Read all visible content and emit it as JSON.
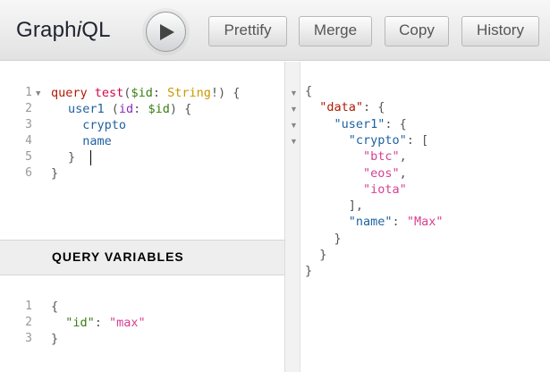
{
  "app": {
    "logo_prefix": "Graph",
    "logo_italic": "i",
    "logo_suffix": "QL"
  },
  "toolbar": {
    "execute_icon": "play-icon",
    "prettify_label": "Prettify",
    "merge_label": "Merge",
    "copy_label": "Copy",
    "history_label": "History"
  },
  "query_editor": {
    "line_numbers": [
      "1",
      "2",
      "3",
      "4",
      "5",
      "6"
    ],
    "lines": [
      [
        {
          "t": "query",
          "c": "kw"
        },
        {
          "t": " ",
          "c": "punc"
        },
        {
          "t": "test",
          "c": "def"
        },
        {
          "t": "(",
          "c": "punc"
        },
        {
          "t": "$id",
          "c": "var"
        },
        {
          "t": ": ",
          "c": "punc"
        },
        {
          "t": "String",
          "c": "type"
        },
        {
          "t": "!) {",
          "c": "punc"
        }
      ],
      [
        {
          "t": "  user1",
          "c": "prop"
        },
        {
          "t": " (",
          "c": "punc"
        },
        {
          "t": "id",
          "c": "attr"
        },
        {
          "t": ": ",
          "c": "punc"
        },
        {
          "t": "$id",
          "c": "var"
        },
        {
          "t": ") {",
          "c": "punc"
        }
      ],
      [
        {
          "t": "    crypto",
          "c": "prop"
        }
      ],
      [
        {
          "t": "    name",
          "c": "prop"
        }
      ],
      [
        {
          "t": "  }",
          "c": "punc"
        }
      ],
      [
        {
          "t": "}",
          "c": "punc"
        }
      ]
    ]
  },
  "variables": {
    "title": "QUERY VARIABLES",
    "line_numbers": [
      "1",
      "2",
      "3"
    ],
    "lines": [
      [
        {
          "t": "{",
          "c": "punc"
        }
      ],
      [
        {
          "t": "  \"id\"",
          "c": "var"
        },
        {
          "t": ": ",
          "c": "punc"
        },
        {
          "t": "\"max\"",
          "c": "str"
        }
      ],
      [
        {
          "t": "}",
          "c": "punc"
        }
      ]
    ]
  },
  "result": {
    "lines": [
      [
        {
          "t": "{",
          "c": "punc"
        }
      ],
      [
        {
          "t": "  \"data\"",
          "c": "jkey-data"
        },
        {
          "t": ": {",
          "c": "punc"
        }
      ],
      [
        {
          "t": "    \"user1\"",
          "c": "jkey"
        },
        {
          "t": ": {",
          "c": "punc"
        }
      ],
      [
        {
          "t": "      \"crypto\"",
          "c": "jkey"
        },
        {
          "t": ": [",
          "c": "punc"
        }
      ],
      [
        {
          "t": "        \"btc\"",
          "c": "str"
        },
        {
          "t": ",",
          "c": "punc"
        }
      ],
      [
        {
          "t": "        \"eos\"",
          "c": "str"
        },
        {
          "t": ",",
          "c": "punc"
        }
      ],
      [
        {
          "t": "        \"iota\"",
          "c": "str"
        }
      ],
      [
        {
          "t": "      ],",
          "c": "punc"
        }
      ],
      [
        {
          "t": "      \"name\"",
          "c": "jkey"
        },
        {
          "t": ": ",
          "c": "punc"
        },
        {
          "t": "\"Max\"",
          "c": "str"
        }
      ],
      [
        {
          "t": "    }",
          "c": "punc"
        }
      ],
      [
        {
          "t": "  }",
          "c": "punc"
        }
      ],
      [
        {
          "t": "}",
          "c": "punc"
        }
      ]
    ]
  },
  "colors": {
    "keyword": "#b11a04",
    "definition": "#d2054e",
    "variable": "#397d13",
    "attribute": "#8b2bb9",
    "type": "#ca9800",
    "property": "#1f61a0",
    "string": "#d64292"
  }
}
